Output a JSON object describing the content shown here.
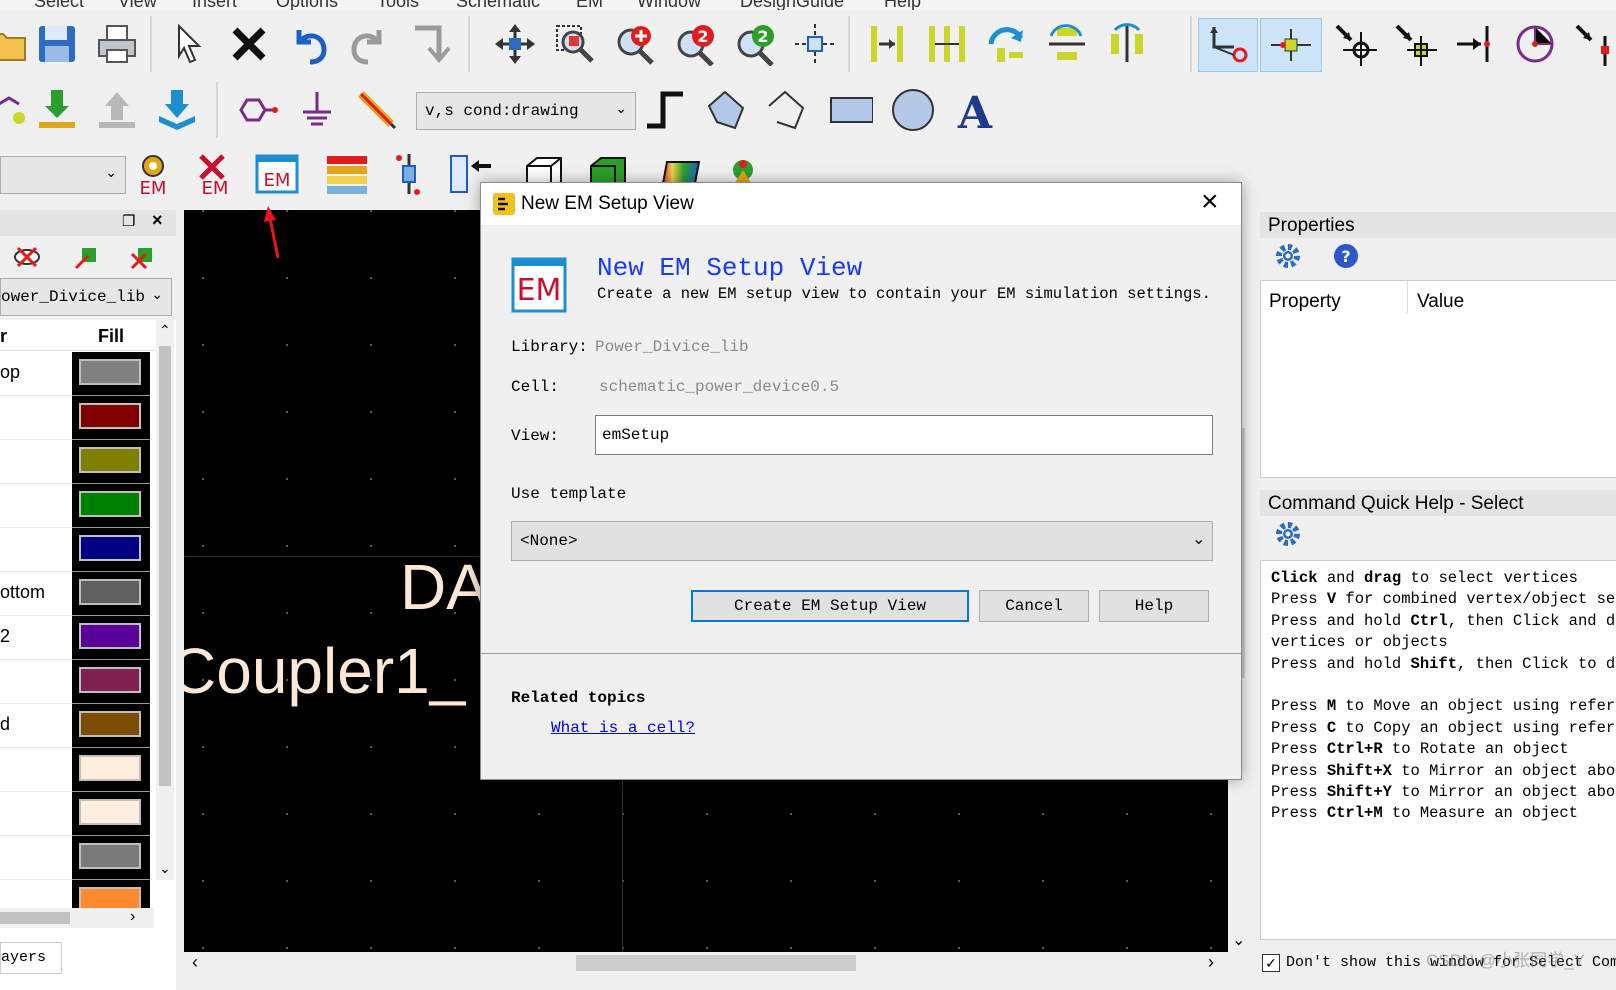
{
  "menu": [
    "Select",
    "View",
    "Insert",
    "Options",
    "Tools",
    "Schematic",
    "EM",
    "Window",
    "DesignGuide",
    "Help"
  ],
  "toolbar2": {
    "layer_select": "v,s cond:drawing"
  },
  "toolbar3": {
    "left_combo": ""
  },
  "layers_panel": {
    "library_combo": "ower_Divice_lib",
    "col_name": "r",
    "col_fill": "Fill",
    "rows": [
      {
        "name": "op",
        "fill": "#808080"
      },
      {
        "name": "",
        "fill": "#800000"
      },
      {
        "name": "",
        "fill": "#808000"
      },
      {
        "name": "",
        "fill": "#008000"
      },
      {
        "name": "",
        "fill": "#000080"
      },
      {
        "name": "ottom",
        "fill": "#606060"
      },
      {
        "name": "2",
        "fill": "#5a0098"
      },
      {
        "name": "",
        "fill": "#802050"
      },
      {
        "name": "d",
        "fill": "#7a4d00"
      },
      {
        "name": "",
        "fill": "#ffeedd"
      },
      {
        "name": "",
        "fill": "#ffeedd"
      },
      {
        "name": "",
        "fill": "#7a7a7a"
      },
      {
        "name": "",
        "fill": "#ff8a30"
      }
    ],
    "tab_label": "ayers"
  },
  "canvas": {
    "text1": "DA",
    "text2": "Coupler1_"
  },
  "dialog": {
    "title": "New EM Setup View",
    "header_title": "New EM Setup View",
    "header_desc": "Create a new EM setup view to contain your EM simulation settings.",
    "icon_text": "EM",
    "library_label": "Library:",
    "library_value": "Power_Divice_lib",
    "cell_label": "Cell:",
    "cell_value": "schematic_power_device0.5",
    "view_label": "View:",
    "view_value": "emSetup",
    "template_label": "Use template",
    "template_value": "<None>",
    "create_button": "Create EM Setup View",
    "cancel_button": "Cancel",
    "help_button": "Help",
    "related_title": "Related topics",
    "related_link": "What is a cell?"
  },
  "properties": {
    "title": "Properties",
    "col_property": "Property",
    "col_value": "Value"
  },
  "quick_help": {
    "title": "Command Quick Help - Select",
    "lines": [
      [
        {
          "t": "Click",
          "b": true
        },
        {
          "t": " and "
        },
        {
          "t": "drag",
          "b": true
        },
        {
          "t": " to select vertices"
        }
      ],
      [
        {
          "t": "Press "
        },
        {
          "t": "V",
          "b": true
        },
        {
          "t": " for combined vertex/object sele"
        }
      ],
      [
        {
          "t": "Press and hold "
        },
        {
          "t": "Ctrl",
          "b": true
        },
        {
          "t": ", then Click and dra"
        }
      ],
      [
        {
          "t": "vertices or objects"
        }
      ],
      [
        {
          "t": "Press and hold "
        },
        {
          "t": "Shift",
          "b": true
        },
        {
          "t": ", then Click to des"
        }
      ],
      [
        {
          "t": ""
        }
      ],
      [
        {
          "t": "Press "
        },
        {
          "t": "M",
          "b": true
        },
        {
          "t": " to Move an object using referen"
        }
      ],
      [
        {
          "t": "Press "
        },
        {
          "t": "C",
          "b": true
        },
        {
          "t": " to Copy an object using referen"
        }
      ],
      [
        {
          "t": "Press "
        },
        {
          "t": "Ctrl+R",
          "b": true
        },
        {
          "t": " to Rotate an object"
        }
      ],
      [
        {
          "t": "Press "
        },
        {
          "t": "Shift+X",
          "b": true
        },
        {
          "t": " to Mirror an object abou"
        }
      ],
      [
        {
          "t": "Press "
        },
        {
          "t": "Shift+Y",
          "b": true
        },
        {
          "t": " to Mirror an object abou"
        }
      ],
      [
        {
          "t": "Press "
        },
        {
          "t": "Ctrl+M",
          "b": true
        },
        {
          "t": " to Measure an object"
        }
      ]
    ],
    "checkbox_label": "Don't show this window for Select Com"
  },
  "watermark": "CSDN @小张同学_Y",
  "colors": {
    "em_red": "#c8102e",
    "accent_blue": "#0078d7",
    "annotation_red": "#e8141e",
    "link_blue": "#0000ee",
    "title_blue": "#1a3cf0"
  }
}
